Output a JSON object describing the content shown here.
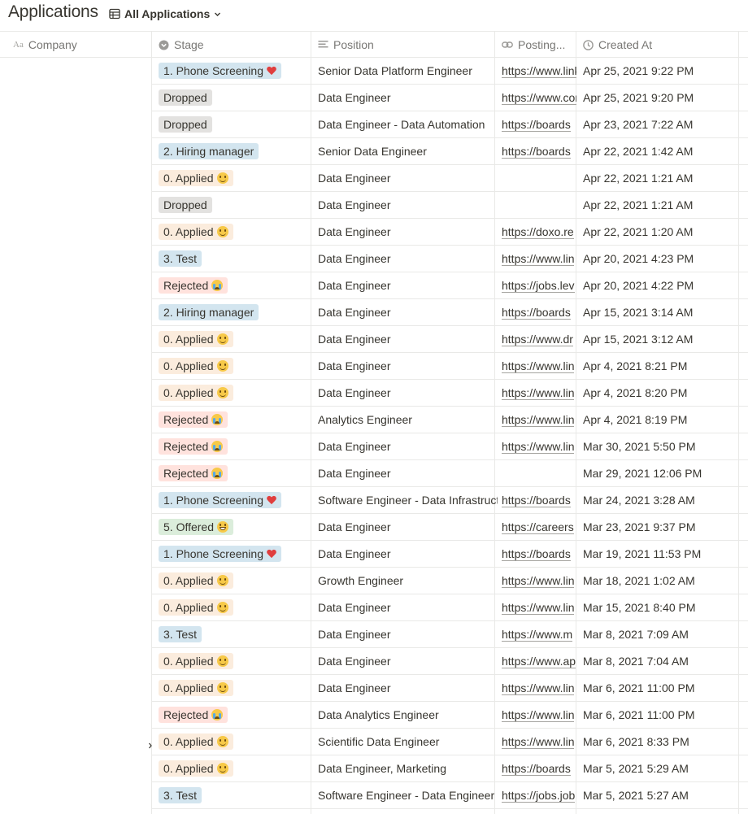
{
  "header": {
    "title": "Applications",
    "view_label": "All Applications"
  },
  "columns": {
    "company": "Company",
    "stage": "Stage",
    "position": "Position",
    "posting": "Posting...",
    "created_at": "Created At"
  },
  "stage_styles": {
    "applied": {
      "bg": "#fbecdd",
      "emoji": "smile"
    },
    "phone": {
      "bg": "#d3e5ef",
      "emoji": "heart"
    },
    "hiring": {
      "bg": "#d3e5ef",
      "emoji": ""
    },
    "test": {
      "bg": "#d3e5ef",
      "emoji": ""
    },
    "dropped": {
      "bg": "#e3e2e0",
      "emoji": ""
    },
    "rejected": {
      "bg": "#ffe2dd",
      "emoji": "cry"
    },
    "offered": {
      "bg": "#dbeddb",
      "emoji": "grin"
    }
  },
  "rows": [
    {
      "stage": "1. Phone Screening",
      "kind": "phone",
      "position": "Senior Data Platform Engineer",
      "posting": "https://www.linkedin.com",
      "created": "Apr 25, 2021 9:22 PM"
    },
    {
      "stage": "Dropped",
      "kind": "dropped",
      "position": "Data Engineer",
      "posting": "https://www.comp",
      "created": "Apr 25, 2021 9:20 PM"
    },
    {
      "stage": "Dropped",
      "kind": "dropped",
      "position": "Data Engineer - Data Automation",
      "posting": "https://boards",
      "created": "Apr 23, 2021 7:22 AM"
    },
    {
      "stage": "2. Hiring manager",
      "kind": "hiring",
      "position": "Senior Data Engineer",
      "posting": "https://boards",
      "created": "Apr 22, 2021 1:42 AM"
    },
    {
      "stage": "0. Applied",
      "kind": "applied",
      "position": "Data Engineer",
      "posting": "",
      "created": "Apr 22, 2021 1:21 AM"
    },
    {
      "stage": "Dropped",
      "kind": "dropped",
      "position": "Data Engineer",
      "posting": "",
      "created": "Apr 22, 2021 1:21 AM"
    },
    {
      "stage": "0. Applied",
      "kind": "applied",
      "position": "Data Engineer",
      "posting": "https://doxo.re",
      "created": "Apr 22, 2021 1:20 AM"
    },
    {
      "stage": "3. Test",
      "kind": "test",
      "position": "Data Engineer",
      "posting": "https://www.lin",
      "created": "Apr 20, 2021 4:23 PM"
    },
    {
      "stage": "Rejected",
      "kind": "rejected",
      "position": "Data Engineer",
      "posting": "https://jobs.lev",
      "created": "Apr 20, 2021 4:22 PM"
    },
    {
      "stage": "2. Hiring manager",
      "kind": "hiring",
      "position": "Data Engineer",
      "posting": "https://boards",
      "created": "Apr 15, 2021 3:14 AM"
    },
    {
      "stage": "0. Applied",
      "kind": "applied",
      "position": "Data Engineer",
      "posting": "https://www.dr",
      "created": "Apr 15, 2021 3:12 AM"
    },
    {
      "stage": "0. Applied",
      "kind": "applied",
      "position": "Data Engineer",
      "posting": "https://www.lin",
      "created": "Apr 4, 2021 8:21 PM"
    },
    {
      "stage": "0. Applied",
      "kind": "applied",
      "position": "Data Engineer",
      "posting": "https://www.lin",
      "created": "Apr 4, 2021 8:20 PM"
    },
    {
      "stage": "Rejected",
      "kind": "rejected",
      "position": "Analytics Engineer",
      "posting": "https://www.lin",
      "created": "Apr 4, 2021 8:19 PM"
    },
    {
      "stage": "Rejected",
      "kind": "rejected",
      "position": "Data Engineer",
      "posting": "https://www.lin",
      "created": "Mar 30, 2021 5:50 PM"
    },
    {
      "stage": "Rejected",
      "kind": "rejected",
      "position": "Data Engineer",
      "posting": "",
      "created": "Mar 29, 2021 12:06 PM"
    },
    {
      "stage": "1. Phone Screening",
      "kind": "phone",
      "position": "Software Engineer - Data Infrastructure",
      "posting": "https://boards",
      "created": "Mar 24, 2021 3:28 AM"
    },
    {
      "stage": "5. Offered",
      "kind": "offered",
      "position": "Data Engineer",
      "posting": "https://careers",
      "created": "Mar 23, 2021 9:37 PM"
    },
    {
      "stage": "1. Phone Screening",
      "kind": "phone",
      "position": "Data Engineer",
      "posting": "https://boards",
      "created": "Mar 19, 2021 11:53 PM"
    },
    {
      "stage": "0. Applied",
      "kind": "applied",
      "position": "Growth Engineer",
      "posting": "https://www.lin",
      "created": "Mar 18, 2021 1:02 AM"
    },
    {
      "stage": "0. Applied",
      "kind": "applied",
      "position": "Data Engineer",
      "posting": "https://www.lin",
      "created": "Mar 15, 2021 8:40 PM"
    },
    {
      "stage": "3. Test",
      "kind": "test",
      "position": "Data Engineer",
      "posting": "https://www.m",
      "created": "Mar 8, 2021 7:09 AM"
    },
    {
      "stage": "0. Applied",
      "kind": "applied",
      "position": "Data Engineer",
      "posting": "https://www.ap",
      "created": "Mar 8, 2021 7:04 AM"
    },
    {
      "stage": "0. Applied",
      "kind": "applied",
      "position": "Data Engineer",
      "posting": "https://www.lin",
      "created": "Mar 6, 2021 11:00 PM"
    },
    {
      "stage": "Rejected",
      "kind": "rejected",
      "position": "Data Analytics Engineer",
      "posting": "https://www.lin",
      "created": "Mar 6, 2021 11:00 PM"
    },
    {
      "stage": "0. Applied",
      "kind": "applied",
      "position": "Scientific Data Engineer",
      "posting": "https://www.lin",
      "created": "Mar 6, 2021 8:33 PM"
    },
    {
      "stage": "0. Applied",
      "kind": "applied",
      "position": "Data Engineer, Marketing",
      "posting": "https://boards",
      "created": "Mar 5, 2021 5:29 AM"
    },
    {
      "stage": "3. Test",
      "kind": "test",
      "position": "Software Engineer - Data Engineer",
      "posting": "https://jobs.job",
      "created": "Mar 5, 2021 5:27 AM"
    }
  ]
}
